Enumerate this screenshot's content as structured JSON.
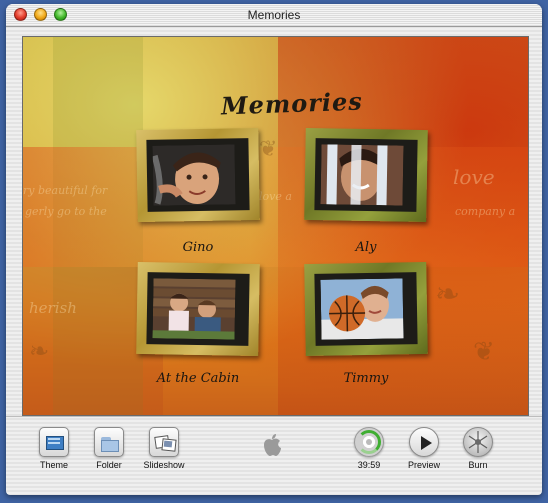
{
  "window": {
    "title": "Memories"
  },
  "menu": {
    "title": "Memories",
    "background_text": [
      "ry beautiful for",
      "gerly go to the",
      "herish",
      "love a",
      "company a",
      "love"
    ],
    "items": [
      {
        "label": "Gino",
        "frame": "gold"
      },
      {
        "label": "Aly",
        "frame": "green"
      },
      {
        "label": "At the Cabin",
        "frame": "gold"
      },
      {
        "label": "Timmy",
        "frame": "green"
      }
    ]
  },
  "toolbar": {
    "theme_label": "Theme",
    "folder_label": "Folder",
    "slideshow_label": "Slideshow",
    "time_label": "39:59",
    "preview_label": "Preview",
    "burn_label": "Burn"
  },
  "colors": {
    "desktop": "#3f63a3",
    "frame_gold": "#c9ad4a",
    "frame_green": "#7f8a30"
  }
}
